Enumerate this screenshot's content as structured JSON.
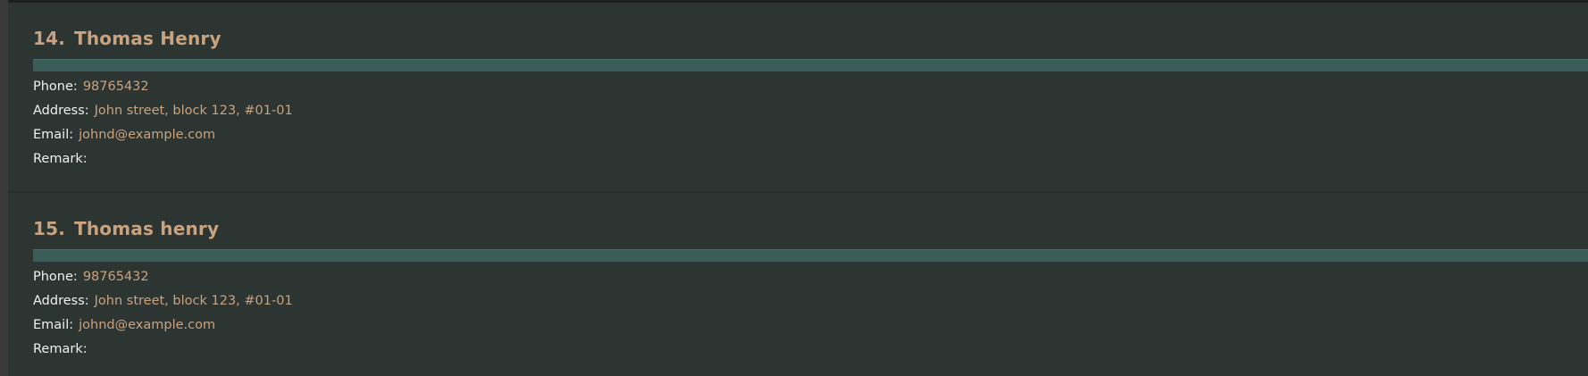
{
  "persons": [
    {
      "index": "14.",
      "name": "Thomas Henry",
      "phone_label": "Phone:",
      "phone": "98765432",
      "address_label": "Address:",
      "address": "John street, block 123, #01-01",
      "email_label": "Email:",
      "email": "johnd@example.com",
      "remark_label": "Remark:",
      "remark": ""
    },
    {
      "index": "15.",
      "name": "Thomas henry",
      "phone_label": "Phone:",
      "phone": "98765432",
      "address_label": "Address:",
      "address": "John street, block 123, #01-01",
      "email_label": "Email:",
      "email": "johnd@example.com",
      "remark_label": "Remark:",
      "remark": ""
    }
  ],
  "colors": {
    "background": "#2b3431",
    "card": "#2d3533",
    "accent_text": "#c9a27e",
    "label_text": "#eef0ee",
    "tag_bar": "#3b5d5a"
  }
}
